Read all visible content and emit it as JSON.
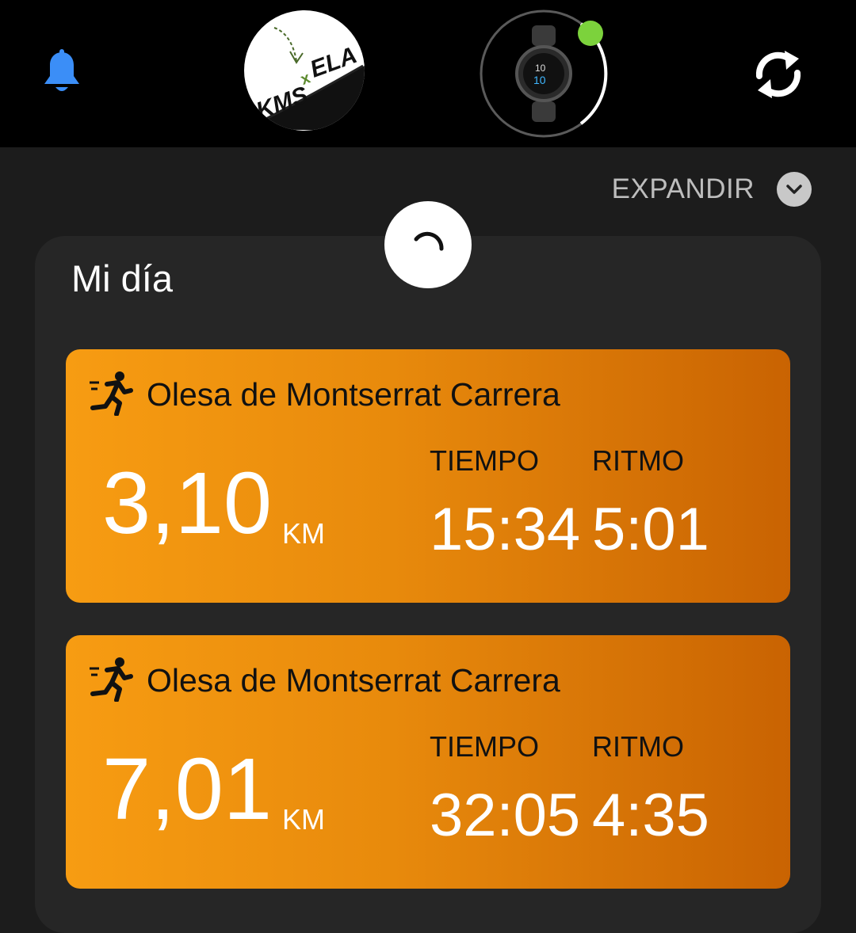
{
  "header": {
    "profile_name": "KMSxELA",
    "device_name": "Forerunner watch",
    "colors": {
      "background": "#000000",
      "device_status": "#7cd23c",
      "bell": "#3b8ef7"
    }
  },
  "expand": {
    "label": "EXPANDIR"
  },
  "my_day": {
    "title": "Mi día",
    "activities": [
      {
        "icon": "running-icon",
        "title": "Olesa de Montserrat Carrera",
        "distance": "3,10",
        "unit": "KM",
        "time_label": "TIEMPO",
        "time": "15:34",
        "pace_label": "RITMO",
        "pace": "5:01"
      },
      {
        "icon": "running-icon",
        "title": "Olesa de Montserrat Carrera",
        "distance": "7,01",
        "unit": "KM",
        "time_label": "TIEMPO",
        "time": "32:05",
        "pace_label": "RITMO",
        "pace": "4:35"
      }
    ],
    "card_colors": {
      "start": "#f79c12",
      "end": "#c96302"
    }
  }
}
